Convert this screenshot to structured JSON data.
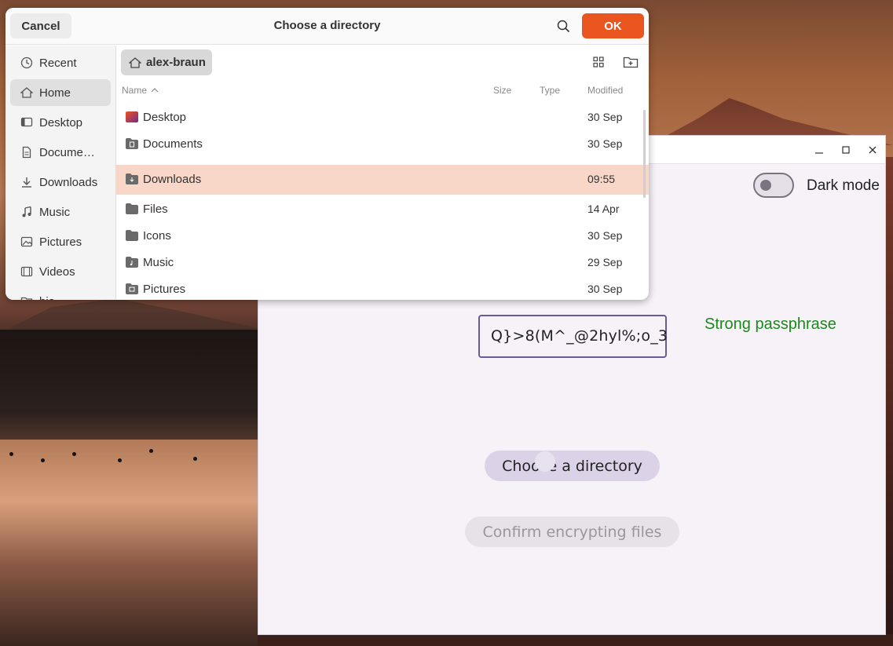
{
  "dialog": {
    "title": "Choose a directory",
    "cancel_label": "Cancel",
    "ok_label": "OK",
    "path_bar": "alex-braun",
    "columns": {
      "name": "Name",
      "size": "Size",
      "type": "Type",
      "modified": "Modified"
    },
    "sidebar": [
      {
        "label": "Recent",
        "icon": "clock-icon"
      },
      {
        "label": "Home",
        "icon": "home-icon",
        "active": true
      },
      {
        "label": "Desktop",
        "icon": "desktop-icon"
      },
      {
        "label": "Docume…",
        "icon": "document-icon"
      },
      {
        "label": "Downloads",
        "icon": "download-icon"
      },
      {
        "label": "Music",
        "icon": "music-icon"
      },
      {
        "label": "Pictures",
        "icon": "picture-icon"
      },
      {
        "label": "Videos",
        "icon": "video-icon"
      },
      {
        "label": "bia",
        "icon": "folder-icon"
      }
    ],
    "files": [
      {
        "name": "Desktop",
        "modified": "30 Sep",
        "icon": "desktop-folder-icon"
      },
      {
        "name": "Documents",
        "modified": "30 Sep",
        "icon": "documents-folder-icon"
      },
      {
        "name": "Downloads",
        "modified": "09:55",
        "icon": "downloads-folder-icon",
        "selected": true
      },
      {
        "name": "Files",
        "modified": "14 Apr",
        "icon": "folder-icon"
      },
      {
        "name": "Icons",
        "modified": "30 Sep",
        "icon": "folder-icon"
      },
      {
        "name": "Music",
        "modified": "29 Sep",
        "icon": "music-folder-icon"
      },
      {
        "name": "Pictures",
        "modified": "30 Sep",
        "icon": "pictures-folder-icon"
      }
    ]
  },
  "app": {
    "dark_mode_label": "Dark mode",
    "passphrase_value": "Q}>8(M^_@2hyl%;o_3",
    "strength_label": "Strong passphrase",
    "choose_dir_label": "Choose a directory",
    "confirm_label": "Confirm encrypting files"
  },
  "colors": {
    "accent": "#e9541f",
    "selection": "#f8d6c8",
    "strength": "#1a8a1a",
    "input_border": "#6a5a9a"
  }
}
